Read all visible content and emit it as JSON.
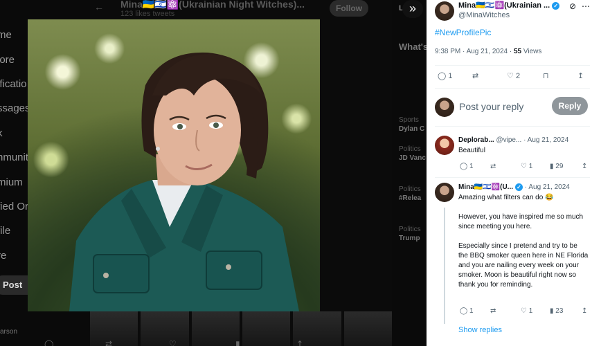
{
  "background": {
    "nav": [
      "me",
      "lore",
      "ificatio",
      "ssages",
      "k",
      "nmuniti",
      "mium",
      "fied Or",
      "file",
      "re"
    ],
    "post_label": "Post",
    "header_title": "Mina🇺🇦🇮🇱⚛️(Ukrainian Night Witches)...",
    "header_sub": "123 likes tweets",
    "follow_label": "Follow",
    "right_heading": "What's",
    "right_items": [
      {
        "tag": "Sports",
        "title": "Dylan C"
      },
      {
        "tag": "Politics",
        "title": "JD Vanc"
      },
      {
        "tag": "Politics",
        "title": "#Relea"
      },
      {
        "tag": "Politics",
        "title": "Trump"
      }
    ],
    "top_right_text": "Lo",
    "bottom_name": "arson"
  },
  "modal": {
    "expand_glyph": "»"
  },
  "post": {
    "author_name": "Mina🇺🇦🇮🇱⚛️(Ukrainian ...",
    "author_handle": "@MinaWitches",
    "text": "#NewProfilePic",
    "time": "9:38 PM · Aug 21, 2024 · ",
    "views_count": "55",
    "views_label": "Views",
    "replies": "1",
    "likes": "2",
    "reply_placeholder": "Post your reply",
    "reply_button": "Reply"
  },
  "comments": [
    {
      "name": "Deplorab...",
      "handle": "@vipe...",
      "date": "· Aug 21, 2024",
      "text": "Beautiful",
      "replies": "1",
      "likes": "1",
      "views": "29"
    },
    {
      "name": "Mina🇺🇦🇮🇱⚛️(U...",
      "handle": "",
      "date": "· Aug 21, 2024",
      "text": "Amazing what filters can do 😂\n\nHowever, you have inspired me so much since meeting you here.\n\nEspecially since I pretend and try to be the BBQ smoker queen here in NE Florida\nand you are nailing every week on your smoker. Moon is beautiful right now so thank you for reminding.",
      "replies": "1",
      "likes": "1",
      "views": "23"
    }
  ],
  "show_replies": "Show replies",
  "colors": {
    "accent": "#1d9bf0",
    "reply_button": "#8f969b",
    "panel_bg": "#ffffff"
  }
}
